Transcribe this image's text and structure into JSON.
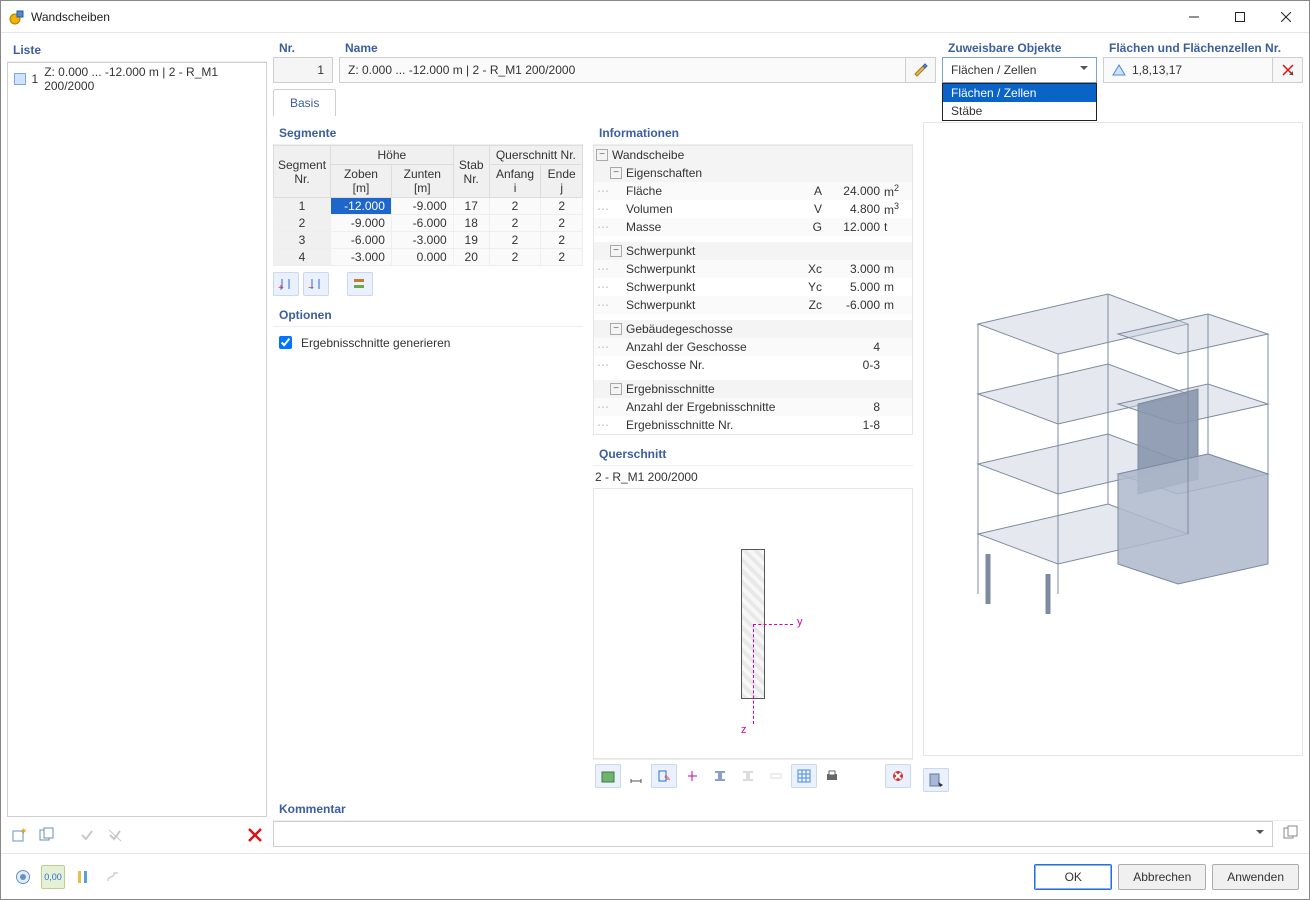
{
  "window": {
    "title": "Wandscheiben"
  },
  "list": {
    "title": "Liste",
    "item_no": "1",
    "item_text": "Z: 0.000 ... -12.000 m | 2 - R_M1 200/2000"
  },
  "fields": {
    "nr_label": "Nr.",
    "nr_value": "1",
    "name_label": "Name",
    "name_value": "Z: 0.000 ... -12.000  m | 2 - R_M1 200/2000",
    "assignable_label": "Zuweisbare Objekte",
    "assignable_value": "Flächen / Zellen",
    "assignable_opt1": "Flächen / Zellen",
    "assignable_opt2": "Stäbe",
    "faces_label": "Flächen und Flächenzellen Nr.",
    "faces_value": "1,8,13,17"
  },
  "tabs": {
    "basis": "Basis"
  },
  "segments": {
    "title": "Segmente",
    "h_segment": "Segment\nNr.",
    "h_hoehe": "Höhe",
    "h_zoben": "Zoben [m]",
    "h_zunten": "Zunten [m]",
    "h_stab": "Stab\nNr.",
    "h_quer": "Querschnitt Nr.",
    "h_anfang": "Anfang i",
    "h_ende": "Ende j",
    "rows": [
      {
        "nr": "1",
        "zo": "-12.000",
        "zu": "-9.000",
        "stab": "17",
        "qi": "2",
        "qj": "2"
      },
      {
        "nr": "2",
        "zo": "-9.000",
        "zu": "-6.000",
        "stab": "18",
        "qi": "2",
        "qj": "2"
      },
      {
        "nr": "3",
        "zo": "-6.000",
        "zu": "-3.000",
        "stab": "19",
        "qi": "2",
        "qj": "2"
      },
      {
        "nr": "4",
        "zo": "-3.000",
        "zu": "0.000",
        "stab": "20",
        "qi": "2",
        "qj": "2"
      }
    ]
  },
  "options": {
    "title": "Optionen",
    "gen_results": "Ergebnisschnitte generieren"
  },
  "info": {
    "title": "Informationen",
    "wand": "Wandscheibe",
    "eig": "Eigenschaften",
    "flaeche": "Fläche",
    "flaeche_sym": "A",
    "flaeche_val": "24.000",
    "flaeche_unit": "m",
    "vol": "Volumen",
    "vol_sym": "V",
    "vol_val": "4.800",
    "vol_unit": "m",
    "masse": "Masse",
    "masse_sym": "G",
    "masse_val": "12.000",
    "masse_unit": "t",
    "sp": "Schwerpunkt",
    "sp_x": "Schwerpunkt",
    "sp_x_sym": "Xc",
    "sp_x_val": "3.000",
    "sp_x_unit": "m",
    "sp_y": "Schwerpunkt",
    "sp_y_sym": "Yc",
    "sp_y_val": "5.000",
    "sp_y_unit": "m",
    "sp_z": "Schwerpunkt",
    "sp_z_sym": "Zc",
    "sp_z_val": "-6.000",
    "sp_z_unit": "m",
    "gesch": "Gebäudegeschosse",
    "gesch_n": "Anzahl der Geschosse",
    "gesch_n_val": "4",
    "gesch_nr": "Geschosse Nr.",
    "gesch_nr_val": "0-3",
    "erg": "Ergebnisschnitte",
    "erg_n": "Anzahl der Ergebnisschnitte",
    "erg_n_val": "8",
    "erg_nr": "Ergebnisschnitte Nr.",
    "erg_nr_val": "1-8"
  },
  "section": {
    "title": "Querschnitt",
    "value": "2 - R_M1 200/2000",
    "axis_y": "y",
    "axis_z": "z"
  },
  "comment": {
    "title": "Kommentar"
  },
  "buttons": {
    "ok": "OK",
    "cancel": "Abbrechen",
    "apply": "Anwenden"
  }
}
